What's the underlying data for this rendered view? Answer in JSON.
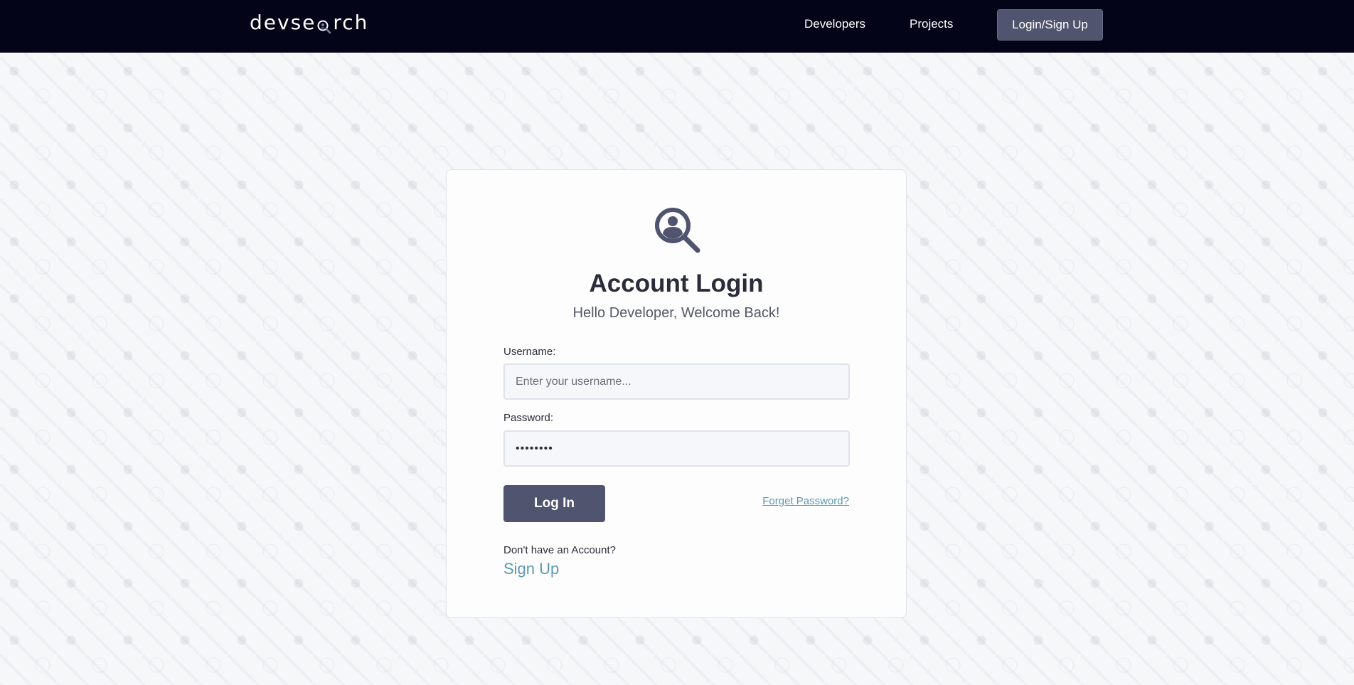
{
  "header": {
    "logo_prefix": "devse",
    "logo_suffix": "rch",
    "logo_icon": "magnifier-icon",
    "nav": {
      "developers": "Developers",
      "projects": "Projects",
      "login_signup": "Login/Sign Up"
    }
  },
  "login_card": {
    "icon": "user-search-icon",
    "title": "Account Login",
    "subtitle": "Hello Developer, Welcome Back!",
    "username": {
      "label": "Username:",
      "placeholder": "Enter your username...",
      "value": ""
    },
    "password": {
      "label": "Password:",
      "value": "••••••••"
    },
    "login_button": "Log In",
    "forgot_password": "Forget Password?",
    "no_account_text": "Don't have an Account?",
    "signup_link": "Sign Up"
  },
  "colors": {
    "navbar_bg": "#030417",
    "primary": "#51546e",
    "link": "#5a9ab0",
    "card_bg": "#fdfdfd",
    "page_bg": "#f6f7f9"
  }
}
